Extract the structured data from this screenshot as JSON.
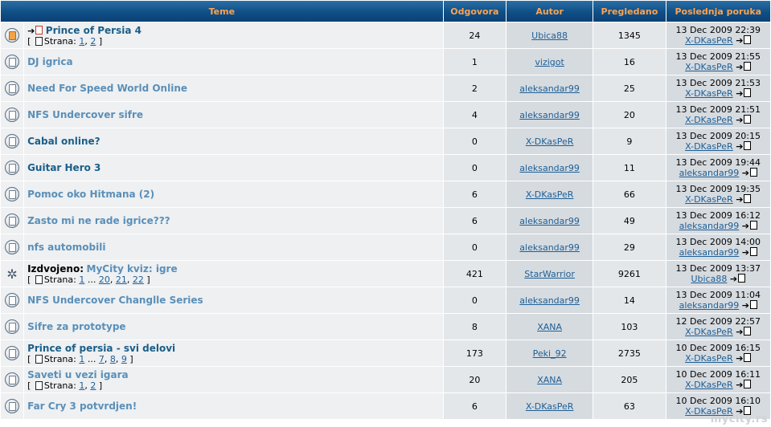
{
  "headers": [
    "Teme",
    "Odgovora",
    "Autor",
    "Pregledano",
    "Poslednja poruka"
  ],
  "pagination_label": "Strana:",
  "sticky_prefix": "Izdvojeno:",
  "watermark": "mycity.rs",
  "topics": [
    {
      "icon": "hot-folder-icon",
      "title": "Prince of Persia 4",
      "read": true,
      "new_arrow": true,
      "pages": [
        "1",
        "2"
      ],
      "replies": "24",
      "author": "Ubica88",
      "views": "1345",
      "last_date": "13 Dec 2009 22:39",
      "last_user": "X-DKasPeR"
    },
    {
      "icon": "folder-icon",
      "title": "DJ igrica",
      "read": false,
      "replies": "1",
      "author": "vizigot",
      "views": "16",
      "last_date": "13 Dec 2009 21:55",
      "last_user": "X-DKasPeR"
    },
    {
      "icon": "folder-icon",
      "title": "Need For Speed World Online",
      "read": false,
      "replies": "2",
      "author": "aleksandar99",
      "views": "25",
      "last_date": "13 Dec 2009 21:53",
      "last_user": "X-DKasPeR"
    },
    {
      "icon": "folder-icon",
      "title": "NFS Undercover sifre",
      "read": false,
      "replies": "4",
      "author": "aleksandar99",
      "views": "20",
      "last_date": "13 Dec 2009 21:51",
      "last_user": "X-DKasPeR"
    },
    {
      "icon": "folder-icon",
      "title": "Cabal online?",
      "read": true,
      "replies": "0",
      "author": "X-DKasPeR",
      "views": "9",
      "last_date": "13 Dec 2009 20:15",
      "last_user": "X-DKasPeR"
    },
    {
      "icon": "folder-icon",
      "title": "Guitar Hero 3",
      "read": true,
      "replies": "0",
      "author": "aleksandar99",
      "views": "11",
      "last_date": "13 Dec 2009 19:44",
      "last_user": "aleksandar99"
    },
    {
      "icon": "folder-icon",
      "title": "Pomoc oko Hitmana (2)",
      "read": false,
      "replies": "6",
      "author": "X-DKasPeR",
      "views": "66",
      "last_date": "13 Dec 2009 19:35",
      "last_user": "X-DKasPeR"
    },
    {
      "icon": "folder-icon",
      "title": "Zasto mi ne rade igrice???",
      "read": false,
      "replies": "6",
      "author": "aleksandar99",
      "views": "49",
      "last_date": "13 Dec 2009 16:12",
      "last_user": "aleksandar99"
    },
    {
      "icon": "folder-icon",
      "title": "nfs automobili",
      "read": false,
      "replies": "0",
      "author": "aleksandar99",
      "views": "29",
      "last_date": "13 Dec 2009 14:00",
      "last_user": "aleksandar99"
    },
    {
      "icon": "sticky-icon",
      "title": "MyCity kviz: igre",
      "read": false,
      "sticky": true,
      "pages": [
        "1",
        "...",
        "20",
        "21",
        "22"
      ],
      "replies": "421",
      "author": "StarWarrior",
      "views": "9261",
      "last_date": "13 Dec 2009 13:37",
      "last_user": "Ubica88"
    },
    {
      "icon": "folder-icon",
      "title": "NFS Undercover Changlle Series",
      "read": false,
      "replies": "0",
      "author": "aleksandar99",
      "views": "14",
      "last_date": "13 Dec 2009 11:04",
      "last_user": "aleksandar99"
    },
    {
      "icon": "folder-icon",
      "title": "Sifre za prototype",
      "read": false,
      "replies": "8",
      "author": "XANA",
      "views": "103",
      "last_date": "12 Dec 2009 22:57",
      "last_user": "X-DKasPeR"
    },
    {
      "icon": "folder-icon",
      "title": "Prince of persia - svi delovi",
      "read": true,
      "pages": [
        "1",
        "...",
        "7",
        "8",
        "9"
      ],
      "replies": "173",
      "author": "Peki_92",
      "views": "2735",
      "last_date": "10 Dec 2009 16:15",
      "last_user": "X-DKasPeR"
    },
    {
      "icon": "folder-icon",
      "title": "Saveti u vezi igara",
      "read": false,
      "pages": [
        "1",
        "2"
      ],
      "replies": "20",
      "author": "XANA",
      "views": "205",
      "last_date": "10 Dec 2009 16:11",
      "last_user": "X-DKasPeR"
    },
    {
      "icon": "folder-icon",
      "title": "Far Cry 3 potvrdjen!",
      "read": false,
      "replies": "6",
      "author": "X-DKasPeR",
      "views": "63",
      "last_date": "10 Dec 2009 16:10",
      "last_user": "X-DKasPeR"
    }
  ]
}
